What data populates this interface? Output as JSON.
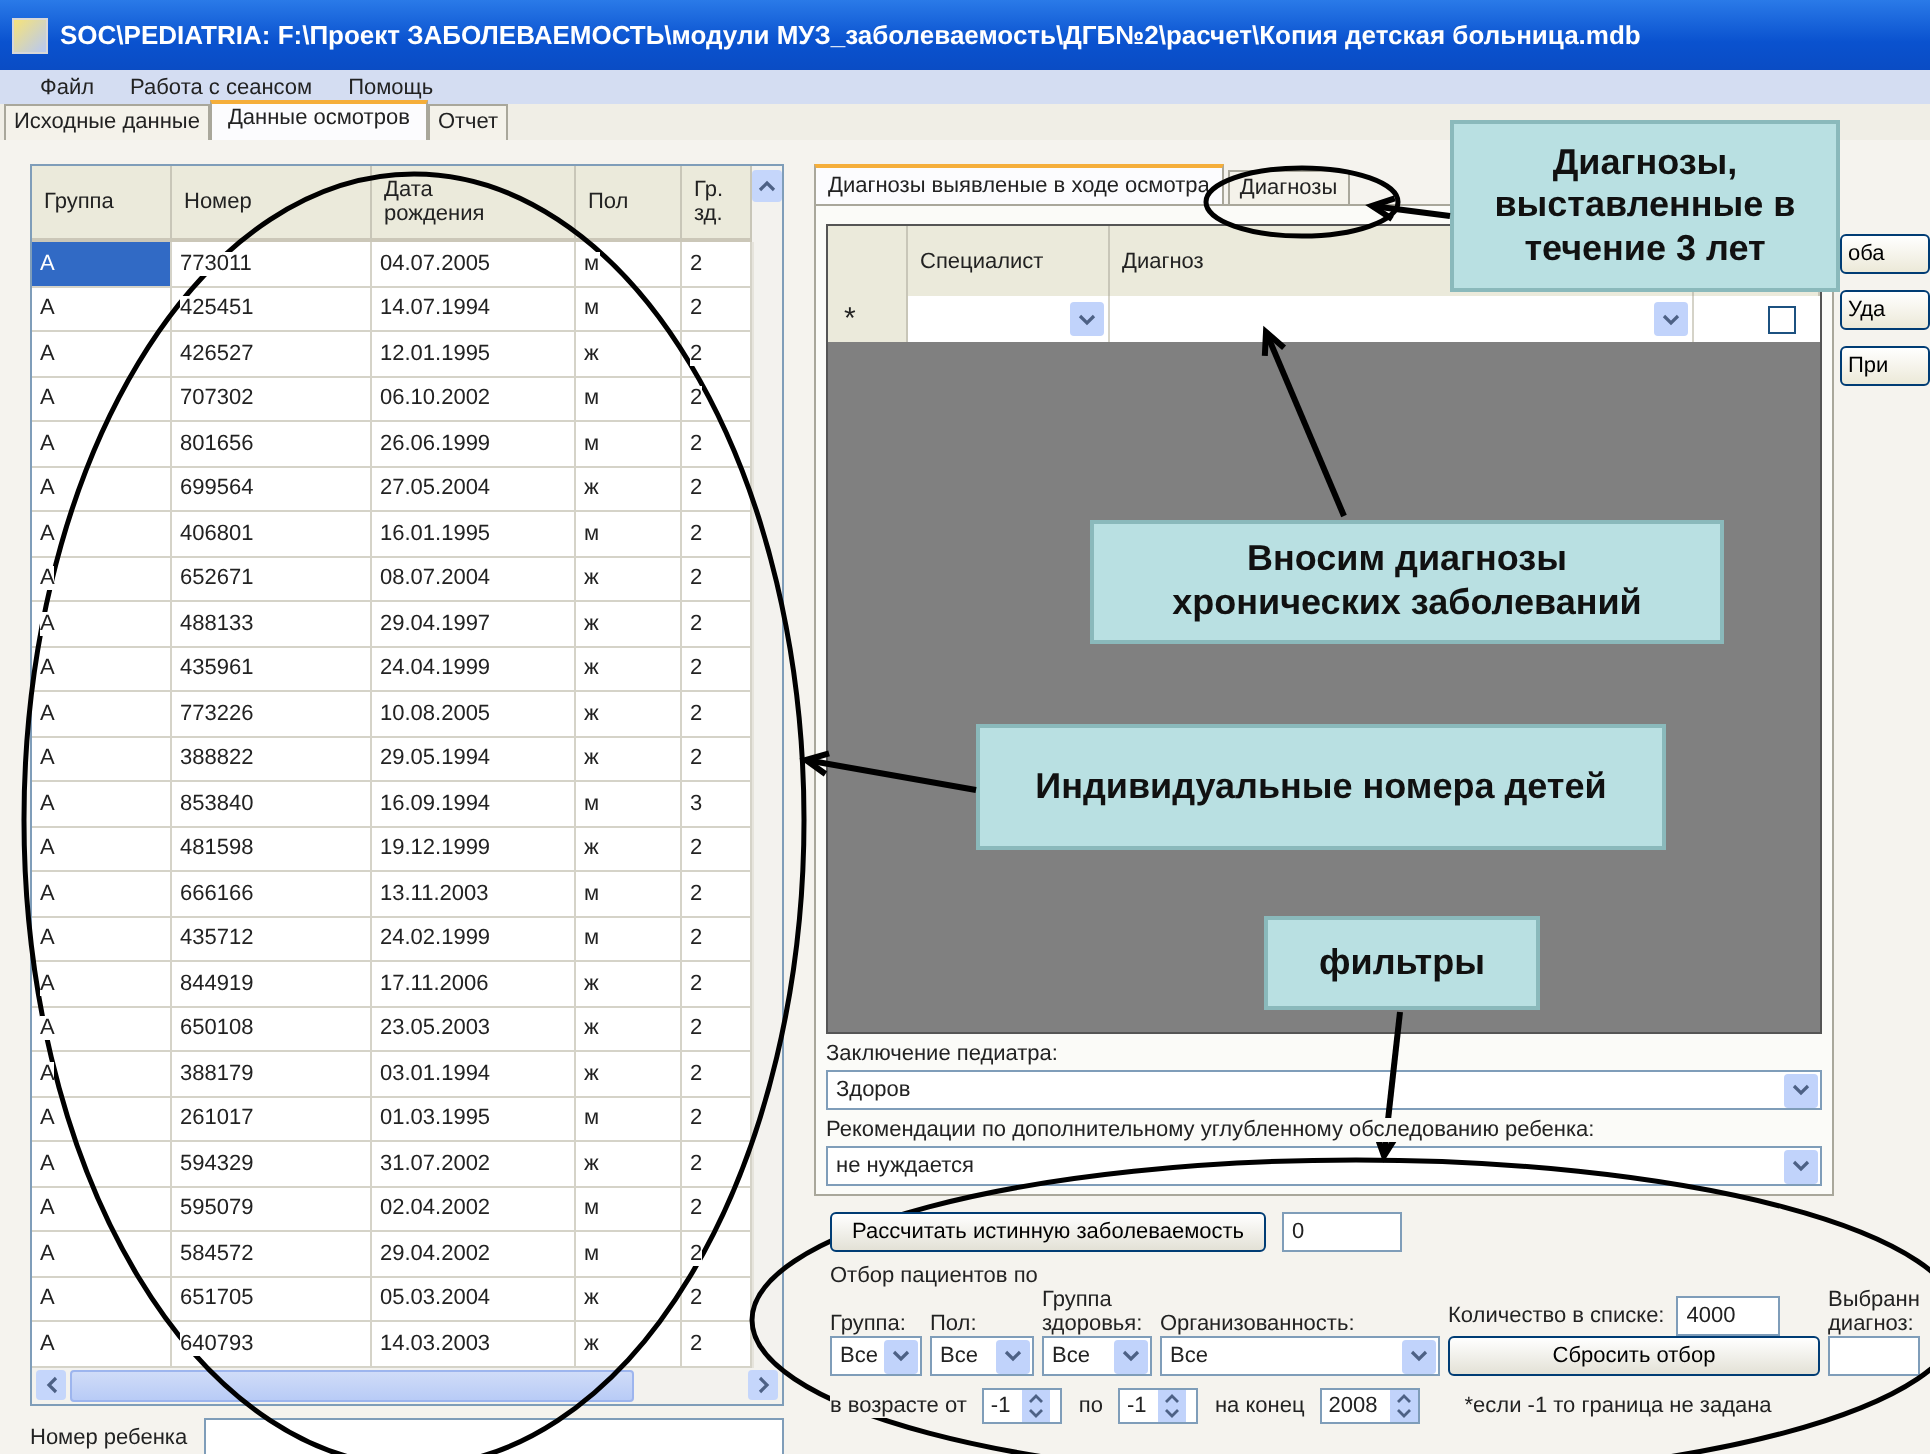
{
  "window": {
    "title": "SOC\\PEDIATRIA: F:\\Проект ЗАБОЛЕВАЕМОСТЬ\\модули МУЗ_заболеваемость\\ДГБ№2\\расчет\\Копия детская больница.mdb"
  },
  "menu": [
    "Файл",
    "Работа с сеансом",
    "Помощь"
  ],
  "tabs": [
    {
      "label": "Исходные данные",
      "selected": false
    },
    {
      "label": "Данные осмотров",
      "selected": true
    },
    {
      "label": "Отчет",
      "selected": false
    }
  ],
  "patients_table": {
    "columns": [
      "Группа",
      "Номер",
      "Дата рождения",
      "Пол",
      "Гр. зд."
    ],
    "rows": [
      {
        "group": "А",
        "number": "773011",
        "birth_date": "04.07.2005",
        "sex": "м",
        "health_group": "2",
        "selected": true
      },
      {
        "group": "А",
        "number": "425451",
        "birth_date": "14.07.1994",
        "sex": "м",
        "health_group": "2",
        "selected": false
      },
      {
        "group": "А",
        "number": "426527",
        "birth_date": "12.01.1995",
        "sex": "ж",
        "health_group": "2",
        "selected": false
      },
      {
        "group": "А",
        "number": "707302",
        "birth_date": "06.10.2002",
        "sex": "м",
        "health_group": "2",
        "selected": false
      },
      {
        "group": "А",
        "number": "801656",
        "birth_date": "26.06.1999",
        "sex": "м",
        "health_group": "2",
        "selected": false
      },
      {
        "group": "А",
        "number": "699564",
        "birth_date": "27.05.2004",
        "sex": "ж",
        "health_group": "2",
        "selected": false
      },
      {
        "group": "А",
        "number": "406801",
        "birth_date": "16.01.1995",
        "sex": "м",
        "health_group": "2",
        "selected": false
      },
      {
        "group": "А",
        "number": "652671",
        "birth_date": "08.07.2004",
        "sex": "ж",
        "health_group": "2",
        "selected": false
      },
      {
        "group": "А",
        "number": "488133",
        "birth_date": "29.04.1997",
        "sex": "ж",
        "health_group": "2",
        "selected": false
      },
      {
        "group": "А",
        "number": "435961",
        "birth_date": "24.04.1999",
        "sex": "ж",
        "health_group": "2",
        "selected": false
      },
      {
        "group": "А",
        "number": "773226",
        "birth_date": "10.08.2005",
        "sex": "ж",
        "health_group": "2",
        "selected": false
      },
      {
        "group": "А",
        "number": "388822",
        "birth_date": "29.05.1994",
        "sex": "ж",
        "health_group": "2",
        "selected": false
      },
      {
        "group": "А",
        "number": "853840",
        "birth_date": "16.09.1994",
        "sex": "м",
        "health_group": "3",
        "selected": false
      },
      {
        "group": "А",
        "number": "481598",
        "birth_date": "19.12.1999",
        "sex": "ж",
        "health_group": "2",
        "selected": false
      },
      {
        "group": "А",
        "number": "666166",
        "birth_date": "13.11.2003",
        "sex": "м",
        "health_group": "2",
        "selected": false
      },
      {
        "group": "А",
        "number": "435712",
        "birth_date": "24.02.1999",
        "sex": "м",
        "health_group": "2",
        "selected": false
      },
      {
        "group": "А",
        "number": "844919",
        "birth_date": "17.11.2006",
        "sex": "ж",
        "health_group": "2",
        "selected": false
      },
      {
        "group": "А",
        "number": "650108",
        "birth_date": "23.05.2003",
        "sex": "ж",
        "health_group": "2",
        "selected": false
      },
      {
        "group": "А",
        "number": "388179",
        "birth_date": "03.01.1994",
        "sex": "ж",
        "health_group": "2",
        "selected": false
      },
      {
        "group": "А",
        "number": "261017",
        "birth_date": "01.03.1995",
        "sex": "м",
        "health_group": "2",
        "selected": false
      },
      {
        "group": "А",
        "number": "594329",
        "birth_date": "31.07.2002",
        "sex": "ж",
        "health_group": "2",
        "selected": false
      },
      {
        "group": "А",
        "number": "595079",
        "birth_date": "02.04.2002",
        "sex": "м",
        "health_group": "2",
        "selected": false
      },
      {
        "group": "А",
        "number": "584572",
        "birth_date": "29.04.2002",
        "sex": "м",
        "health_group": "2",
        "selected": false
      },
      {
        "group": "А",
        "number": "651705",
        "birth_date": "05.03.2004",
        "sex": "ж",
        "health_group": "2",
        "selected": false
      },
      {
        "group": "А",
        "number": "640793",
        "birth_date": "14.03.2003",
        "sex": "ж",
        "health_group": "2",
        "selected": false
      }
    ]
  },
  "child_number": {
    "label": "Номер ребенка"
  },
  "diagnoses_panel": {
    "tabs": [
      {
        "label": "Диагнозы выявленые в ходе осмотра",
        "selected": true
      },
      {
        "label": "Диагнозы",
        "selected": false
      }
    ],
    "columns": [
      "Специалист",
      "Диагноз"
    ],
    "new_row_marker": "*",
    "new_row_checked": false
  },
  "side_buttons": [
    "оба",
    "Уда",
    "При"
  ],
  "conclusion": {
    "label": "Заключение педиатра:",
    "value": "Здоров"
  },
  "recommendations": {
    "label": "Рекомендации по дополнительному  углубленному обследованию ребенка:",
    "value": "не нуждается"
  },
  "calc": {
    "button": "Рассчитать истинную заболеваемость",
    "value": "0"
  },
  "filters": {
    "title": "Отбор пациентов по",
    "group": {
      "label": "Группа:",
      "value": "Все"
    },
    "sex": {
      "label": "Пол:",
      "value": "Все"
    },
    "health_group": {
      "label": "Группа здоровья:",
      "value": "Все"
    },
    "organization": {
      "label": "Организованность:",
      "value": "Все"
    },
    "count": {
      "label": "Количество в списке:",
      "value": "4000"
    },
    "reset_button": "Сбросить отбор",
    "selected_diagnosis": {
      "label": "Выбранн диагноз:"
    },
    "age_from": {
      "label": "в возрасте от",
      "value": "-1"
    },
    "age_to": {
      "label": "по",
      "value": "-1"
    },
    "year_end": {
      "label": "на конец",
      "value": "2008"
    },
    "note": "*если -1 то граница не задана"
  },
  "annotations": [
    {
      "text": "Диагнозы, выставленные в течение 3 лет"
    },
    {
      "text": "Вносим диагнозы хронических заболеваний"
    },
    {
      "text": "Индивидуальные номера детей"
    },
    {
      "text": "фильтры"
    }
  ]
}
